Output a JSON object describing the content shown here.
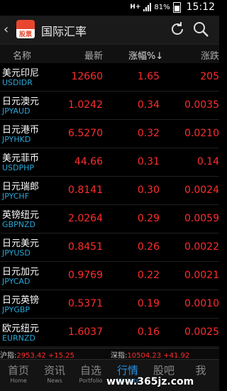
{
  "status": {
    "network": "H+",
    "battery": "81%",
    "time": "15:12"
  },
  "header": {
    "logo_text": "股票",
    "title": "国际汇率"
  },
  "columns": {
    "name": "名称",
    "latest": "最新",
    "change_pct": "涨幅%↓",
    "change": "涨跌"
  },
  "rows": [
    {
      "name": "美元印尼",
      "code": "USDIDR",
      "price": "12660",
      "pct": "1.65",
      "chg": "205"
    },
    {
      "name": "日元澳元",
      "code": "JPYAUD",
      "price": "1.0242",
      "pct": "0.34",
      "chg": "0.0035"
    },
    {
      "name": "日元港币",
      "code": "JPYHKD",
      "price": "6.5270",
      "pct": "0.32",
      "chg": "0.0210"
    },
    {
      "name": "美元菲币",
      "code": "USDPHP",
      "price": "44.66",
      "pct": "0.31",
      "chg": "0.14"
    },
    {
      "name": "日元瑞郎",
      "code": "JPYCHF",
      "price": "0.8141",
      "pct": "0.30",
      "chg": "0.0024"
    },
    {
      "name": "英镑纽元",
      "code": "GBPNZD",
      "price": "2.0264",
      "pct": "0.29",
      "chg": "0.0059"
    },
    {
      "name": "日元美元",
      "code": "JPYUSD",
      "price": "0.8451",
      "pct": "0.26",
      "chg": "0.0022"
    },
    {
      "name": "日元加元",
      "code": "JPYCAD",
      "price": "0.9769",
      "pct": "0.22",
      "chg": "0.0021"
    },
    {
      "name": "日元英镑",
      "code": "JPYGBP",
      "price": "0.5371",
      "pct": "0.19",
      "chg": "0.0010"
    },
    {
      "name": "欧元纽元",
      "code": "EURNZD",
      "price": "1.6037",
      "pct": "0.16",
      "chg": "0.0025"
    }
  ],
  "ticker": {
    "sh_label": "沪指:",
    "sh_value": "2953.42 +15.25",
    "sz_label": "深指:",
    "sz_value": "10504.23 +41.92"
  },
  "nav": [
    {
      "label": "首页",
      "sub": "Home"
    },
    {
      "label": "资讯",
      "sub": "News"
    },
    {
      "label": "自选",
      "sub": "Portfolio"
    },
    {
      "label": "行情",
      "sub": "Markets"
    },
    {
      "label": "股吧",
      "sub": ""
    },
    {
      "label": "我",
      "sub": ""
    }
  ],
  "watermark": "www.365jz.com",
  "colors": {
    "up": "#ff2d2d",
    "code": "#2aa8d8",
    "active_tab": "#2a8fe0",
    "logo": "#e8452e"
  }
}
